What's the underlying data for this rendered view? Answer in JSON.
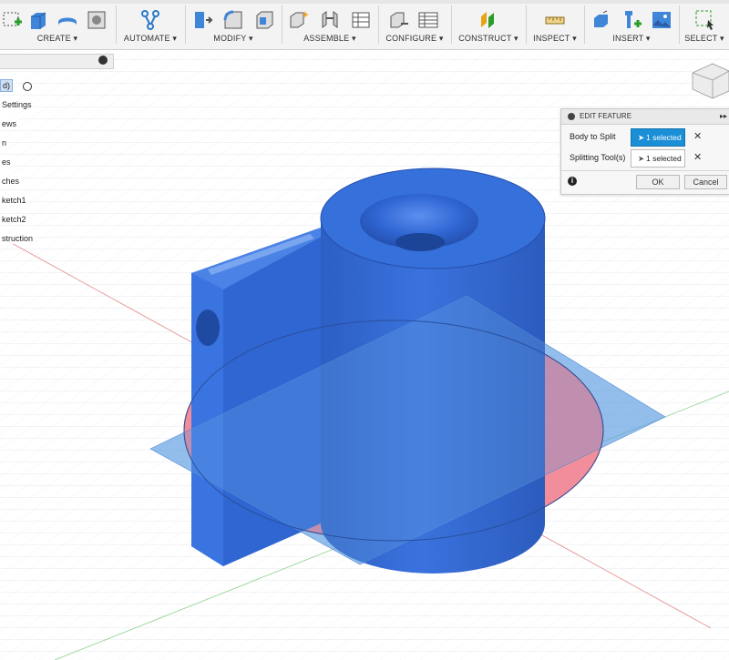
{
  "toolbar": {
    "groups": [
      {
        "label": "CREATE ▾"
      },
      {
        "label": "AUTOMATE ▾"
      },
      {
        "label": "MODIFY ▾"
      },
      {
        "label": "ASSEMBLE ▾"
      },
      {
        "label": "CONFIGURE ▾"
      },
      {
        "label": "CONSTRUCT ▾"
      },
      {
        "label": "INSPECT ▾"
      },
      {
        "label": "INSERT ▾"
      },
      {
        "label": "SELECT ▾"
      }
    ]
  },
  "browser": {
    "items": [
      {
        "label": "d)"
      },
      {
        "label": "Settings"
      },
      {
        "label": "ews"
      },
      {
        "label": "n"
      },
      {
        "label": "es"
      },
      {
        "label": "ches"
      },
      {
        "label": "ketch1"
      },
      {
        "label": "ketch2"
      },
      {
        "label": "struction"
      }
    ]
  },
  "edit_feature": {
    "title": "EDIT FEATURE",
    "body_to_split_label": "Body to Split",
    "body_to_split_value": "1 selected",
    "splitting_tool_label": "Splitting Tool(s)",
    "splitting_tool_value": "1 selected",
    "clear_symbol": "✕",
    "info_symbol": "i",
    "ok_label": "OK",
    "cancel_label": "Cancel"
  },
  "colors": {
    "body_blue": "#2f6ad6",
    "plane_blue": "#5b9be0",
    "section_red": "#f07a8a",
    "selection_blue": "#1a8fd6"
  }
}
